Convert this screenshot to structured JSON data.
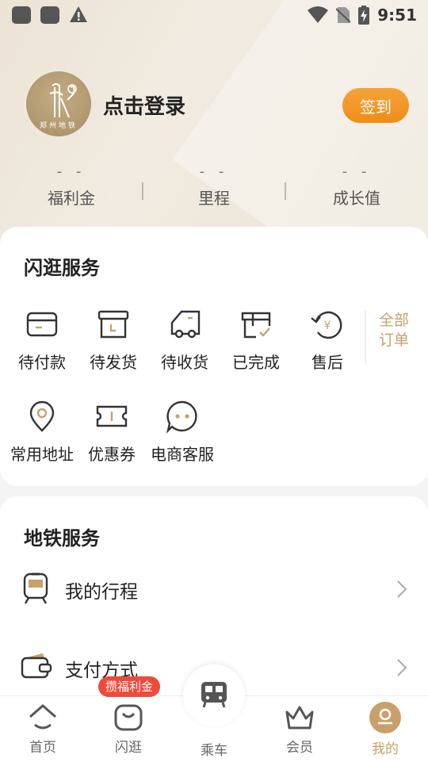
{
  "status_bar": {
    "time": "9:51"
  },
  "profile": {
    "avatar_logo_text": "郑州地铁",
    "login_text": "点击登录",
    "signin_label": "签到"
  },
  "stats": [
    {
      "value": "- -",
      "label": "福利金"
    },
    {
      "value": "- -",
      "label": "里程"
    },
    {
      "value": "- -",
      "label": "成长值"
    }
  ],
  "shop": {
    "title": "闪逛服务",
    "orders": [
      {
        "icon": "wallet-card-icon",
        "label": "待付款"
      },
      {
        "icon": "box-icon",
        "label": "待发货"
      },
      {
        "icon": "truck-icon",
        "label": "待收货"
      },
      {
        "icon": "box-check-icon",
        "label": "已完成"
      },
      {
        "icon": "refund-icon",
        "label": "售后"
      }
    ],
    "all_orders": "全部订单",
    "services": [
      {
        "icon": "location-pin-icon",
        "label": "常用地址"
      },
      {
        "icon": "coupon-icon",
        "label": "优惠券"
      },
      {
        "icon": "chat-icon",
        "label": "电商客服"
      }
    ]
  },
  "metro": {
    "title": "地铁服务",
    "items": [
      {
        "icon": "train-icon",
        "label": "我的行程"
      },
      {
        "icon": "wallet-icon",
        "label": "支付方式"
      }
    ]
  },
  "nav": {
    "badge": "攒福利金",
    "items": [
      {
        "icon": "home-icon",
        "label": "首页"
      },
      {
        "icon": "shopping-bag-icon",
        "label": "闪逛"
      },
      {
        "icon": "bus-icon",
        "label": "乘车"
      },
      {
        "icon": "crown-icon",
        "label": "会员"
      },
      {
        "icon": "profile-icon",
        "label": "我的"
      }
    ],
    "active": "我的"
  },
  "colors": {
    "accent": "#c9a06b",
    "signin": "#f19a28",
    "badge": "#ee4a3a"
  }
}
